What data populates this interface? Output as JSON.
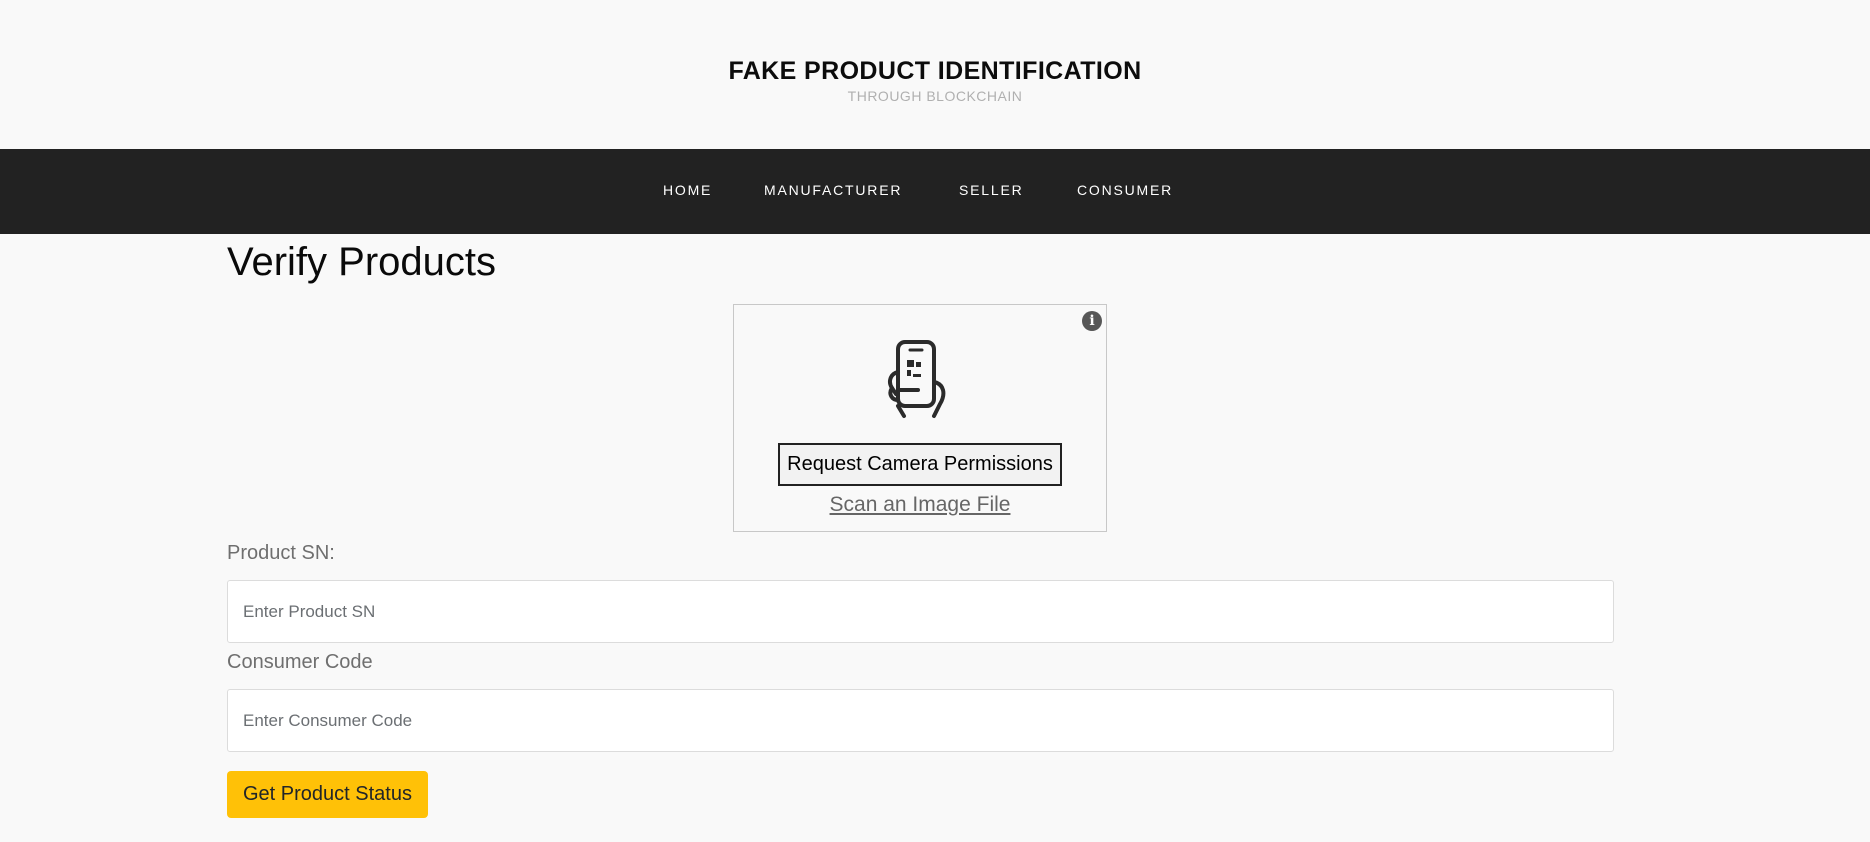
{
  "header": {
    "title": "FAKE PRODUCT IDENTIFICATION",
    "subtitle": "THROUGH BLOCKCHAIN"
  },
  "nav": {
    "items": [
      {
        "label": "HOME"
      },
      {
        "label": "MANUFACTURER"
      },
      {
        "label": "SELLER"
      },
      {
        "label": "CONSUMER"
      }
    ]
  },
  "main": {
    "title": "Verify Products",
    "scanner": {
      "info_icon": "info-icon",
      "illustration_icon": "phone-qr-scan-icon",
      "camera_button_label": "Request Camera Permissions",
      "scan_file_link": "Scan an Image File"
    },
    "form": {
      "product_sn_label": "Product SN:",
      "product_sn_placeholder": "Enter Product SN",
      "product_sn_value": "",
      "consumer_code_label": "Consumer Code",
      "consumer_code_placeholder": "Enter Consumer Code",
      "consumer_code_value": "",
      "submit_label": "Get Product Status"
    }
  },
  "colors": {
    "navbar_bg": "#222222",
    "page_bg": "#f9f9f9",
    "accent_button": "#ffc107"
  }
}
